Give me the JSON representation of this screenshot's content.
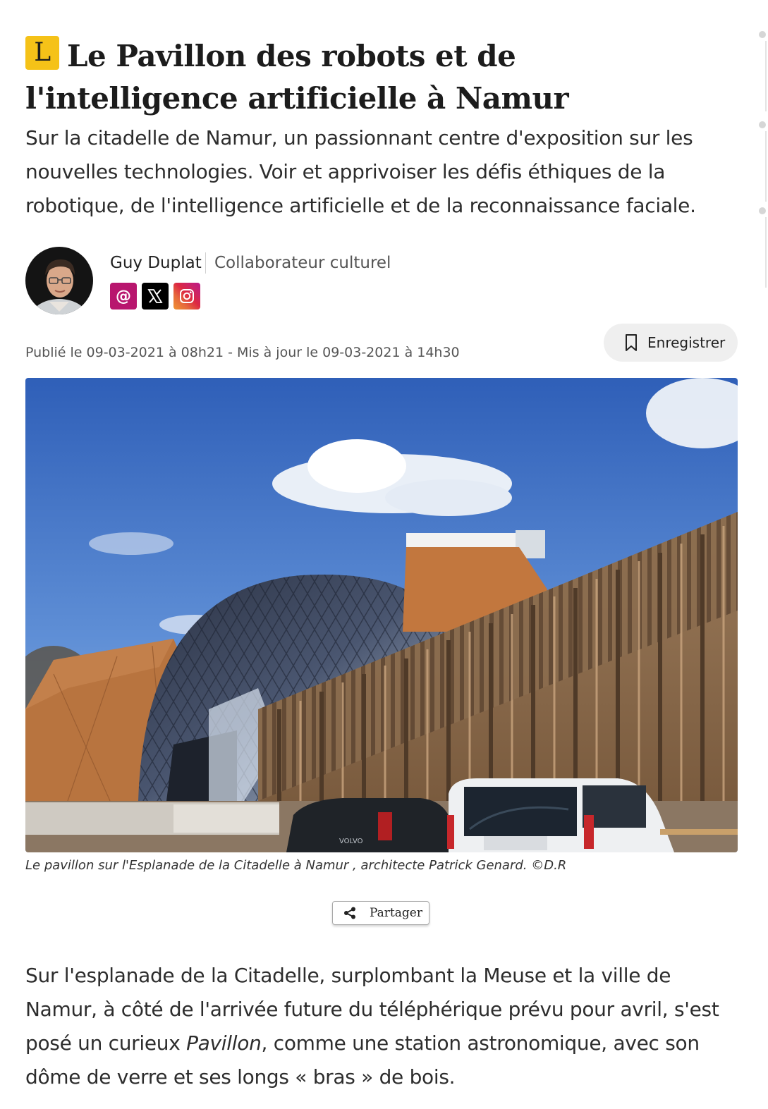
{
  "article": {
    "badge": "L",
    "title": "Le Pavillon des robots et de l'intelligence artificielle à Namur",
    "lead": "Sur la citadelle de Namur, un passionnant centre d'exposition sur les nouvelles technologies. Voir et apprivoiser les défis éthiques de la robotique, de l'intelligence artificielle et de la reconnaissance faciale."
  },
  "author": {
    "name": "Guy Duplat",
    "role": "Collaborateur culturel",
    "socials": [
      "email-icon",
      "x-icon",
      "instagram-icon"
    ]
  },
  "meta": {
    "published": "Publié le 09-03-2021 à 08h21",
    "separator": "-",
    "updated": "Mis à jour le 09-03-2021 à 14h30",
    "save_label": "Enregistrer"
  },
  "photo": {
    "caption": "Le pavillon sur l'Esplanade de la Citadelle à Namur , architecte Patrick Genard. ©D.R",
    "car_brand": "VOLVO"
  },
  "share": {
    "label": "Partager"
  },
  "body": {
    "p1_part1": "Sur l'esplanade de la Citadelle, surplombant la Meuse et la ville de Namur, à côté de l'arrivée future du téléphérique prévu pour avril, s'est posé un curieux ",
    "p1_em": "Pavillon",
    "p1_part2": ", comme une station astronomique, avec son dôme de verre et ses longs « bras » de bois."
  },
  "colors": {
    "badge": "#f5c218",
    "email": "#b8166e",
    "x": "#000000",
    "save_bg": "#efefef"
  }
}
